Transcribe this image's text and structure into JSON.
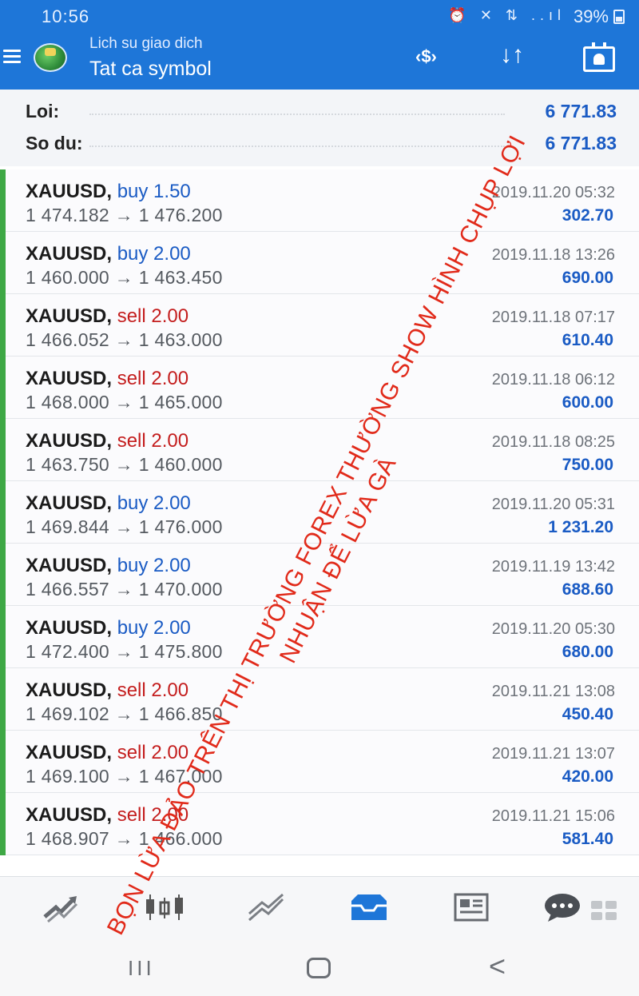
{
  "status_bar": {
    "time": "10:56",
    "icons": "⏰ ✕ ⇅ ..ıl",
    "battery": "39%"
  },
  "header": {
    "subtitle": "Lich su giao dich",
    "title": "Tat ca symbol",
    "currency_icon": "‹$›",
    "sort_icon": "↓↑"
  },
  "summary": {
    "profit_label": "Loi:",
    "profit_value": "6 771.83",
    "balance_label": "So du:",
    "balance_value": "6 771.83"
  },
  "trades": [
    {
      "symbol": "XAUUSD,",
      "side": "buy 1.50",
      "type": "buy",
      "prices": "1 474.182 → 1 476.200",
      "time": "2019.11.20 05:32",
      "profit": "302.70"
    },
    {
      "symbol": "XAUUSD,",
      "side": "buy 2.00",
      "type": "buy",
      "prices": "1 460.000 → 1 463.450",
      "time": "2019.11.18 13:26",
      "profit": "690.00"
    },
    {
      "symbol": "XAUUSD,",
      "side": "sell 2.00",
      "type": "sell",
      "prices": "1 466.052 → 1 463.000",
      "time": "2019.11.18 07:17",
      "profit": "610.40"
    },
    {
      "symbol": "XAUUSD,",
      "side": "sell 2.00",
      "type": "sell",
      "prices": "1 468.000 → 1 465.000",
      "time": "2019.11.18 06:12",
      "profit": "600.00"
    },
    {
      "symbol": "XAUUSD,",
      "side": "sell 2.00",
      "type": "sell",
      "prices": "1 463.750 → 1 460.000",
      "time": "2019.11.18 08:25",
      "profit": "750.00"
    },
    {
      "symbol": "XAUUSD,",
      "side": "buy 2.00",
      "type": "buy",
      "prices": "1 469.844 → 1 476.000",
      "time": "2019.11.20 05:31",
      "profit": "1 231.20"
    },
    {
      "symbol": "XAUUSD,",
      "side": "buy 2.00",
      "type": "buy",
      "prices": "1 466.557 → 1 470.000",
      "time": "2019.11.19 13:42",
      "profit": "688.60"
    },
    {
      "symbol": "XAUUSD,",
      "side": "buy 2.00",
      "type": "buy",
      "prices": "1 472.400 → 1 475.800",
      "time": "2019.11.20 05:30",
      "profit": "680.00"
    },
    {
      "symbol": "XAUUSD,",
      "side": "sell 2.00",
      "type": "sell",
      "prices": "1 469.102 → 1 466.850",
      "time": "2019.11.21 13:08",
      "profit": "450.40"
    },
    {
      "symbol": "XAUUSD,",
      "side": "sell 2.00",
      "type": "sell",
      "prices": "1 469.100 → 1 467.000",
      "time": "2019.11.21 13:07",
      "profit": "420.00"
    },
    {
      "symbol": "XAUUSD,",
      "side": "sell 2.00",
      "type": "sell",
      "prices": "1 468.907 → 1 466.000",
      "time": "2019.11.21 15:06",
      "profit": "581.40"
    }
  ],
  "watermark": {
    "line1": "BỌN LỪA ĐẢO TRÊN THỊ TRƯỜNG FOREX THƯỜNG SHOW HÌNH CHỤP LỢI",
    "line2": "NHUẬN ĐỂ LỪA GÀ"
  },
  "bottom_nav": [
    "quotes-icon",
    "chart-icon",
    "trade-icon",
    "history-icon",
    "news-icon",
    "chat-icon",
    "more-icon"
  ],
  "system_nav": {
    "recent": "III",
    "back": "<"
  },
  "colors": {
    "header_bg": "#1e76d8",
    "buy": "#1a5bc4",
    "sell": "#c41e1e",
    "profit_bar": "#3ea845",
    "active_nav": "#1e76d8",
    "watermark": "#e12a1a"
  }
}
